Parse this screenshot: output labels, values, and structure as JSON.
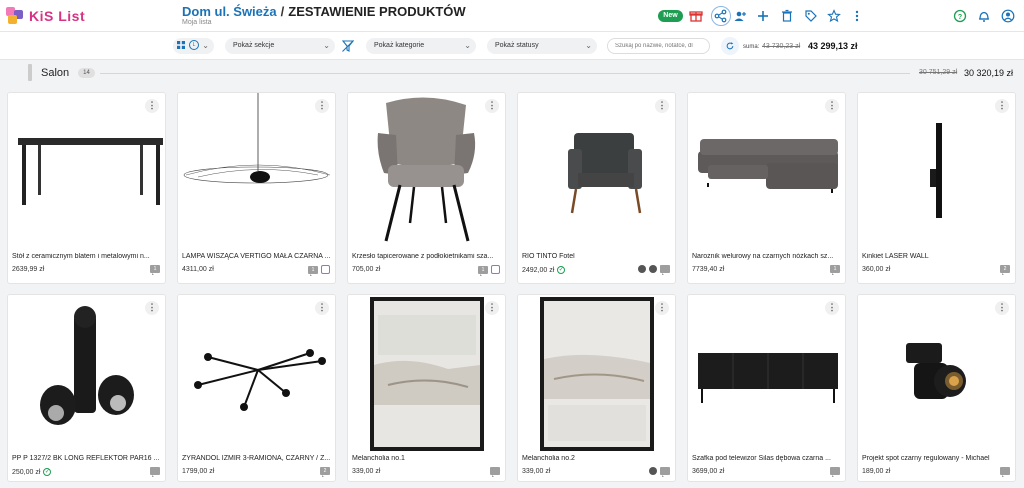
{
  "app": {
    "name": "KiS List"
  },
  "header": {
    "project": "Dom ul. Świeża",
    "separator": "/",
    "page_title": "ZESTAWIENIE PRODUKTÓW",
    "list_name": "Moja lista",
    "new_badge": "New",
    "toolbar_icons": [
      "gift-icon",
      "share-icon",
      "add-user-icon",
      "plus-icon",
      "trash-icon",
      "tag-icon",
      "star-icon",
      "more-icon"
    ],
    "right_icons": [
      "help-icon",
      "bell-icon",
      "account-icon"
    ]
  },
  "filters": {
    "view_toggle": "L",
    "section_select": "Pokaż sekcje",
    "category_select": "Pokaż kategorie",
    "status_select": "Pokaż statusy",
    "search_placeholder": "Szukaj po nazwie, notatce, dl",
    "sum_label": "suma:",
    "sum_old": "43 730,23 zł",
    "sum_new": "43 299,13 zł"
  },
  "section": {
    "title": "Salon",
    "count": "14",
    "total_old": "30 751,29 zł",
    "total_new": "30 320,19 zł"
  },
  "products": [
    {
      "name": "Stół z ceramicznym blatem i metalowymi n...",
      "price": "2639,99 zł",
      "icons": [
        "comment"
      ],
      "comment_count": "1"
    },
    {
      "name": "LAMPA WISZĄCA VERTIGO MAŁA CZARNA ...",
      "price": "4311,00 zł",
      "icons": [
        "comment",
        "note"
      ],
      "comment_count": "1"
    },
    {
      "name": "Krzesło tapicerowane z podłokietnikami sza...",
      "price": "705,00 zł",
      "icons": [
        "comment",
        "note"
      ],
      "comment_count": "1"
    },
    {
      "name": "RIO TINTO Fotel",
      "price": "2492,00 zł",
      "icons": [
        "round",
        "round",
        "comment"
      ],
      "comment_count": "",
      "check": true
    },
    {
      "name": "Narożnik welurowy na czarnych nóżkach sz...",
      "price": "7739,40 zł",
      "icons": [
        "comment"
      ],
      "comment_count": "1"
    },
    {
      "name": "Kinkiet LASER WALL",
      "price": "360,00 zł",
      "icons": [
        "comment"
      ],
      "comment_count": "2"
    },
    {
      "name": "PP P 1327/2 BK LONG REFLEKTOR PAR16 ...",
      "price": "250,00 zł",
      "icons": [
        "comment"
      ],
      "comment_count": "",
      "check": true
    },
    {
      "name": "ŻYRANDOL IZMIR 3-RAMIONA, CZARNY / Z...",
      "price": "1799,00 zł",
      "icons": [
        "comment"
      ],
      "comment_count": "2"
    },
    {
      "name": "Melancholia no.1",
      "price": "339,00 zł",
      "icons": [
        "comment"
      ],
      "comment_count": ""
    },
    {
      "name": "Melancholia no.2",
      "price": "339,00 zł",
      "icons": [
        "round",
        "comment"
      ],
      "comment_count": ""
    },
    {
      "name": "Szafka pod telewizor Silas dębowa czarna ...",
      "price": "3699,00 zł",
      "icons": [
        "comment"
      ],
      "comment_count": ""
    },
    {
      "name": "Projekt spot czarny regulowany - Michael",
      "price": "189,00 zł",
      "icons": [
        "comment"
      ],
      "comment_count": ""
    }
  ],
  "colors": {
    "brand": "#d63384",
    "link": "#1a73b8",
    "new_badge": "#1e9e52",
    "accent_green": "#1e9e52"
  }
}
